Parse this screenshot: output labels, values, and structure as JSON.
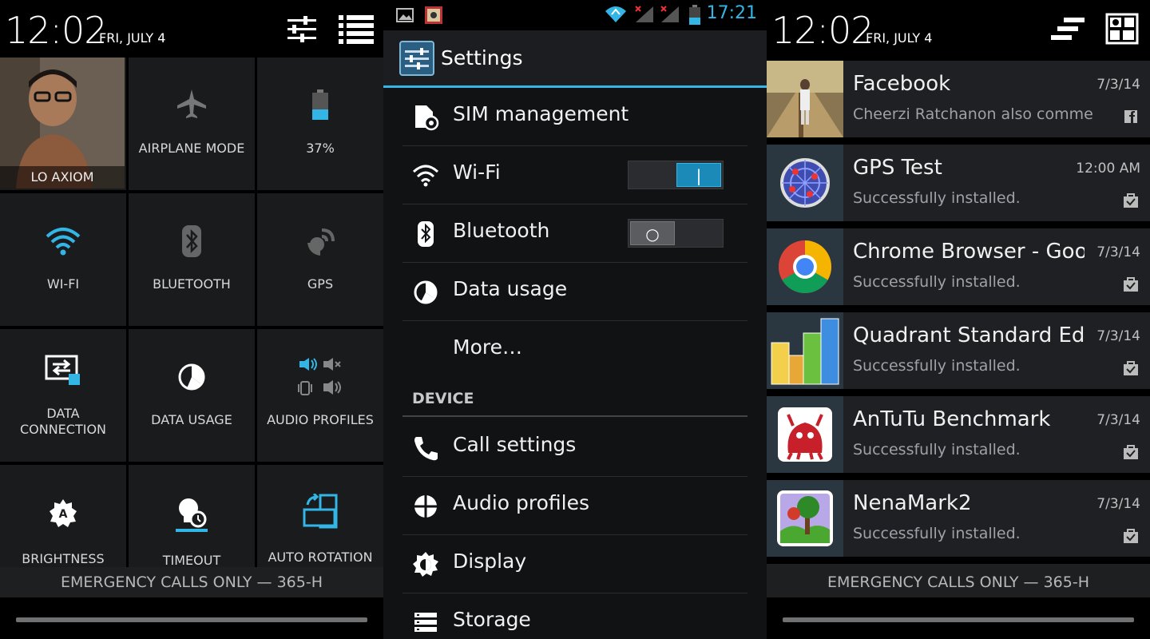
{
  "colors": {
    "accent": "#33b5e5",
    "tile_bg": "#1a1b1d",
    "settings_bg": "#101214"
  },
  "quick_settings": {
    "clock": "12:02",
    "date": "FRI, JULY 4",
    "header_icons": [
      "sliders-icon",
      "list-view-icon"
    ],
    "profile_name": "LO AXIOM",
    "tiles": [
      {
        "label": "AIRPLANE MODE",
        "icon": "airplane-icon"
      },
      {
        "label": "37%",
        "icon": "battery-icon",
        "battery_level": 0.37
      },
      {
        "label": "WI-FI",
        "icon": "wifi-icon"
      },
      {
        "label": "BLUETOOTH",
        "icon": "bluetooth-icon"
      },
      {
        "label": "GPS",
        "icon": "gps-icon"
      },
      {
        "label_line1": "DATA",
        "label_line2": "CONNECTION",
        "icon": "data-connection-icon"
      },
      {
        "label": "DATA USAGE",
        "icon": "data-usage-icon"
      },
      {
        "label": "AUDIO PROFILES",
        "icon": "audio-profiles-icon"
      },
      {
        "label": "BRIGHTNESS",
        "icon": "brightness-icon"
      },
      {
        "label": "TIMEOUT",
        "icon": "timeout-icon"
      },
      {
        "label": "AUTO ROTATION",
        "icon": "auto-rotation-icon"
      }
    ],
    "emergency_text": "EMERGENCY CALLS ONLY — 365-H"
  },
  "settings": {
    "status_time": "17:21",
    "title": "Settings",
    "items": [
      {
        "label": "SIM management",
        "icon": "sim-icon"
      },
      {
        "label": "Wi-Fi",
        "icon": "wifi-icon",
        "toggle": "on"
      },
      {
        "label": "Bluetooth",
        "icon": "bluetooth-icon",
        "toggle": "off"
      },
      {
        "label": "Data usage",
        "icon": "data-usage-icon"
      },
      {
        "label": "More…"
      }
    ],
    "section_device": "DEVICE",
    "device_items": [
      {
        "label": "Call settings",
        "icon": "phone-icon"
      },
      {
        "label": "Audio profiles",
        "icon": "audio-profiles-icon"
      },
      {
        "label": "Display",
        "icon": "display-icon"
      },
      {
        "label": "Storage",
        "icon": "storage-icon"
      }
    ]
  },
  "notifications": {
    "clock": "12:02",
    "date": "FRI, JULY 4",
    "header_icons": [
      "clear-all-icon",
      "quick-settings-icon"
    ],
    "items": [
      {
        "title": "Facebook",
        "text": "Cheerzi Ratchanon also commented",
        "time": "7/3/14",
        "icon": "facebook-photo-icon"
      },
      {
        "title": "GPS Test",
        "text": "Successfully installed.",
        "time": "12:00 AM",
        "icon": "gps-test-icon"
      },
      {
        "title": "Chrome Browser - Google",
        "text": "Successfully installed.",
        "time": "7/3/14",
        "icon": "chrome-icon"
      },
      {
        "title": "Quadrant Standard Edition",
        "text": "Successfully installed.",
        "time": "7/3/14",
        "icon": "quadrant-icon"
      },
      {
        "title": "AnTuTu Benchmark",
        "text": "Successfully installed.",
        "time": "7/3/14",
        "icon": "antutu-icon"
      },
      {
        "title": "NenaMark2",
        "text": "Successfully installed.",
        "time": "7/3/14",
        "icon": "nenamark-icon"
      }
    ],
    "emergency_text": "EMERGENCY CALLS ONLY — 365-H"
  }
}
